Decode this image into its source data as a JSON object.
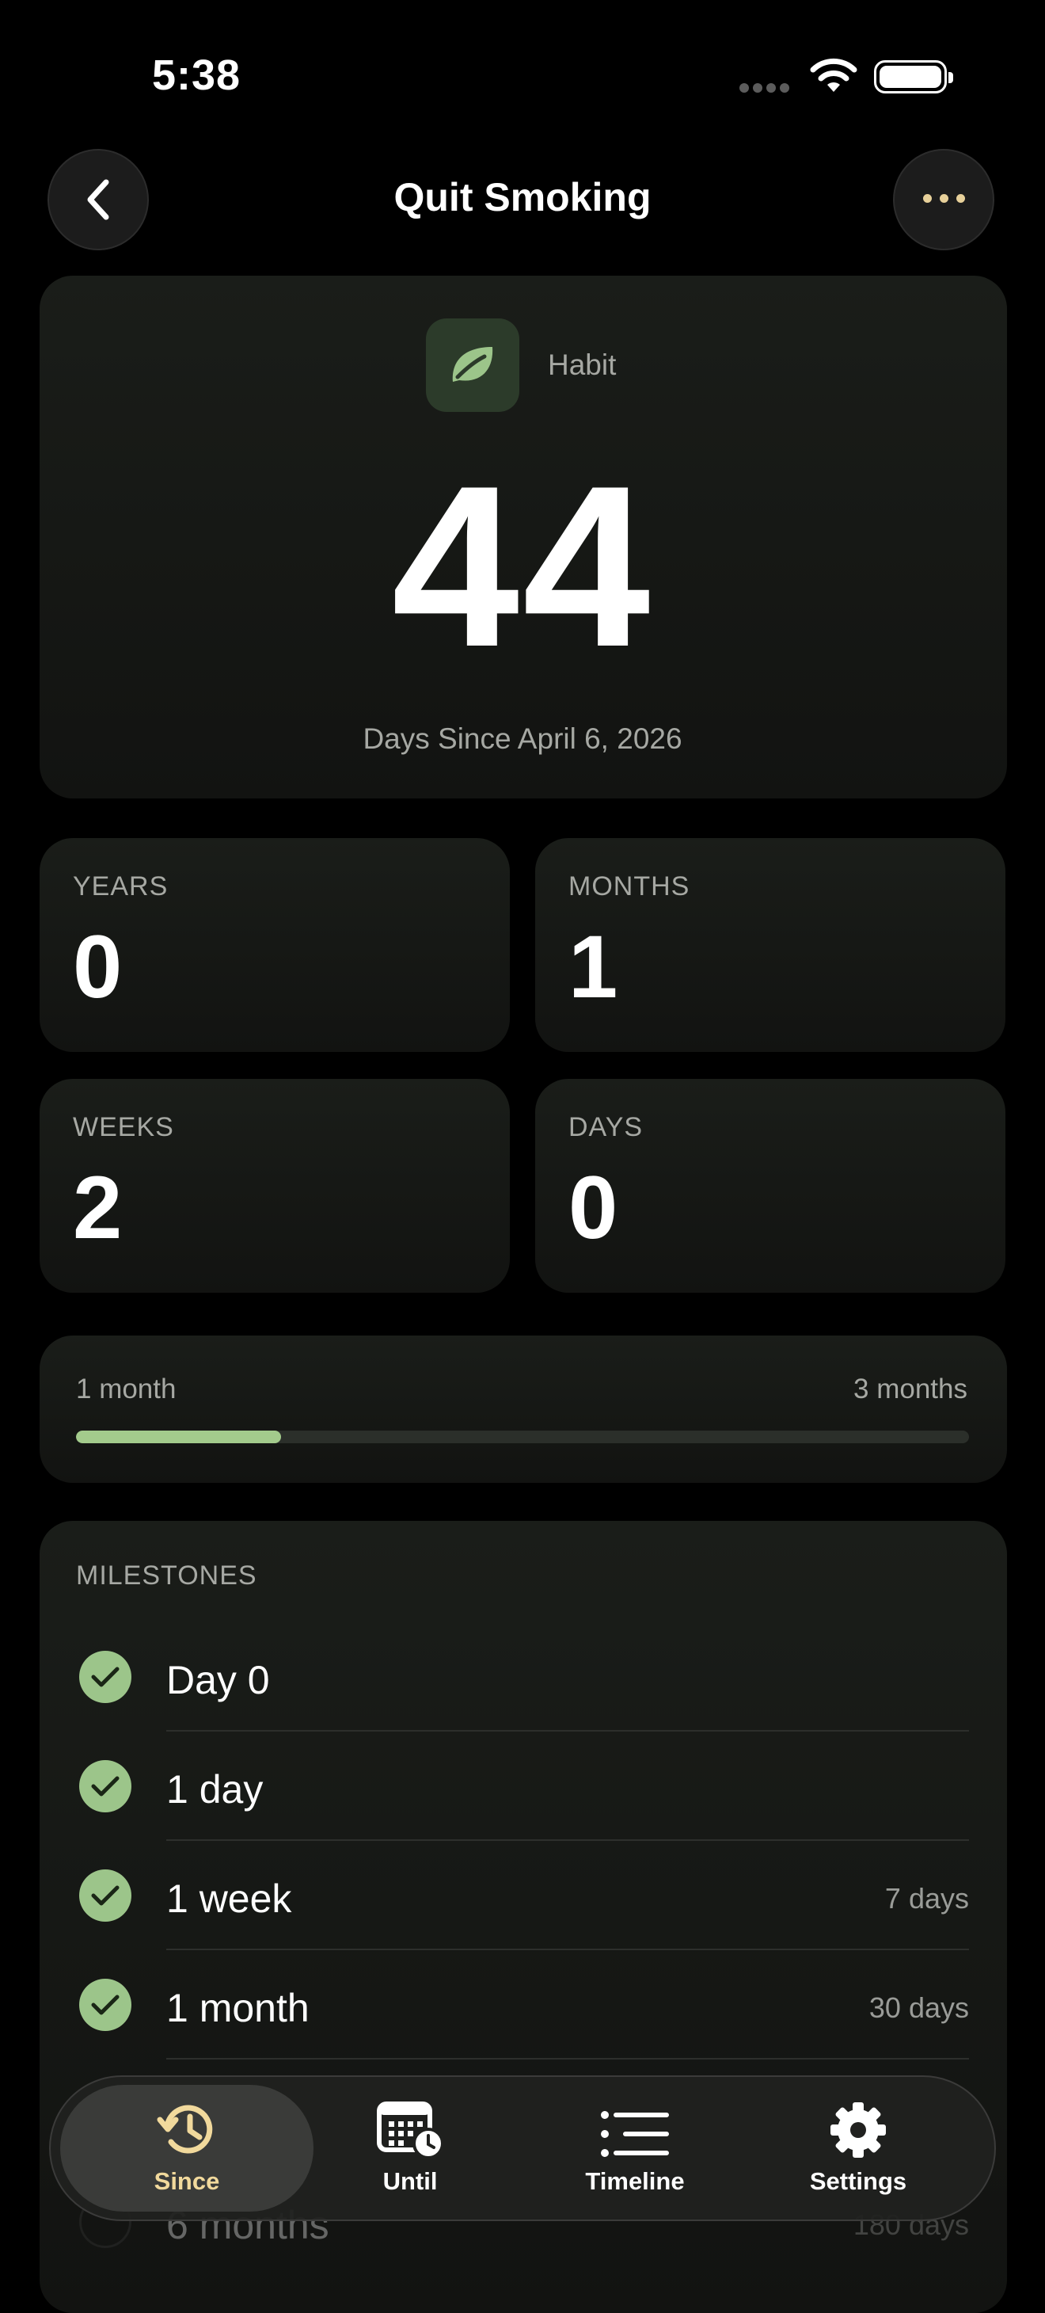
{
  "status_bar": {
    "time": "5:38"
  },
  "nav": {
    "title": "Quit Smoking"
  },
  "hero": {
    "category": "Habit",
    "count": "44",
    "subtitle": "Days Since April 6, 2026"
  },
  "stats": [
    {
      "label": "YEARS",
      "value": "0"
    },
    {
      "label": "MONTHS",
      "value": "1"
    },
    {
      "label": "WEEKS",
      "value": "2"
    },
    {
      "label": "DAYS",
      "value": "0"
    }
  ],
  "progress": {
    "start_label": "1 month",
    "end_label": "3 months",
    "fraction": 0.23
  },
  "milestones": {
    "title": "MILESTONES",
    "items": [
      {
        "name": "Day 0",
        "days": "",
        "done": true
      },
      {
        "name": "1 day",
        "days": "",
        "done": true
      },
      {
        "name": "1 week",
        "days": "7 days",
        "done": true
      },
      {
        "name": "1 month",
        "days": "30 days",
        "done": true
      },
      {
        "name": "6 months",
        "days": "180 days",
        "done": false
      }
    ]
  },
  "tabs": [
    {
      "label": "Since",
      "icon": "clock-history-icon",
      "active": true
    },
    {
      "label": "Until",
      "icon": "calendar-clock-icon",
      "active": false
    },
    {
      "label": "Timeline",
      "icon": "list-icon",
      "active": false
    },
    {
      "label": "Settings",
      "icon": "gear-icon",
      "active": false
    }
  ],
  "colors": {
    "accent": "#a3cb8c",
    "tab_active": "#f1d99c",
    "background": "#000000"
  }
}
